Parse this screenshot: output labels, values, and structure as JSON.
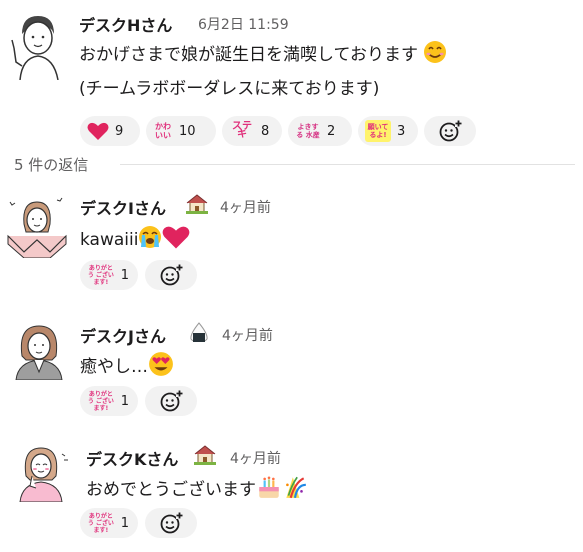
{
  "parent": {
    "author": "デスクHさん",
    "timestamp": "6月2日 11:59",
    "line1": "おかげさまで娘が誕生日を満喫しております",
    "line2": "(チームラボボーダレスに来ております)",
    "reactions": [
      {
        "icon": "red-heart-icon",
        "count": "9"
      },
      {
        "icon": "kawaii-stamp-icon",
        "label": "かわ いい",
        "count": "10"
      },
      {
        "icon": "suteki-stamp-icon",
        "label": "ステキ",
        "count": "8"
      },
      {
        "icon": "yokisuru-suisan-stamp-icon",
        "label": "よきする 水産",
        "count": "2"
      },
      {
        "icon": "negaiteruyo-stamp-icon",
        "label": "願いて るよ!",
        "count": "3"
      }
    ]
  },
  "thread": {
    "reply_count_label": "5 件の返信"
  },
  "replies": [
    {
      "author": "デスクIさん",
      "status_icon": "house-icon",
      "timestamp": "4ヶ月前",
      "text": "kawaiii",
      "emojis": [
        "crying-face-icon",
        "red-heart-icon"
      ],
      "reaction": {
        "icon": "arigatou-gozaimasu-stamp-icon",
        "label": "ありがとう ございます!",
        "count": "1"
      }
    },
    {
      "author": "デスクJさん",
      "status_icon": "rice-ball-icon",
      "timestamp": "4ヶ月前",
      "text": "癒やし…",
      "emojis": [
        "heart-eyes-face-icon"
      ],
      "reaction": {
        "icon": "arigatou-gozaimasu-stamp-icon",
        "label": "ありがとう ございます!",
        "count": "1"
      }
    },
    {
      "author": "デスクKさん",
      "status_icon": "house-icon",
      "timestamp": "4ヶ月前",
      "text": "おめでとうございます",
      "emojis": [
        "birthday-cake-icon",
        "confetti-ball-icon"
      ],
      "reaction": {
        "icon": "arigatou-gozaimasu-stamp-icon",
        "label": "ありがとう ございます!",
        "count": "1"
      }
    }
  ],
  "colors": {
    "pill_bg": "#f2f2f2",
    "stamp_pink": "#e0307b",
    "meta_gray": "#616061"
  }
}
